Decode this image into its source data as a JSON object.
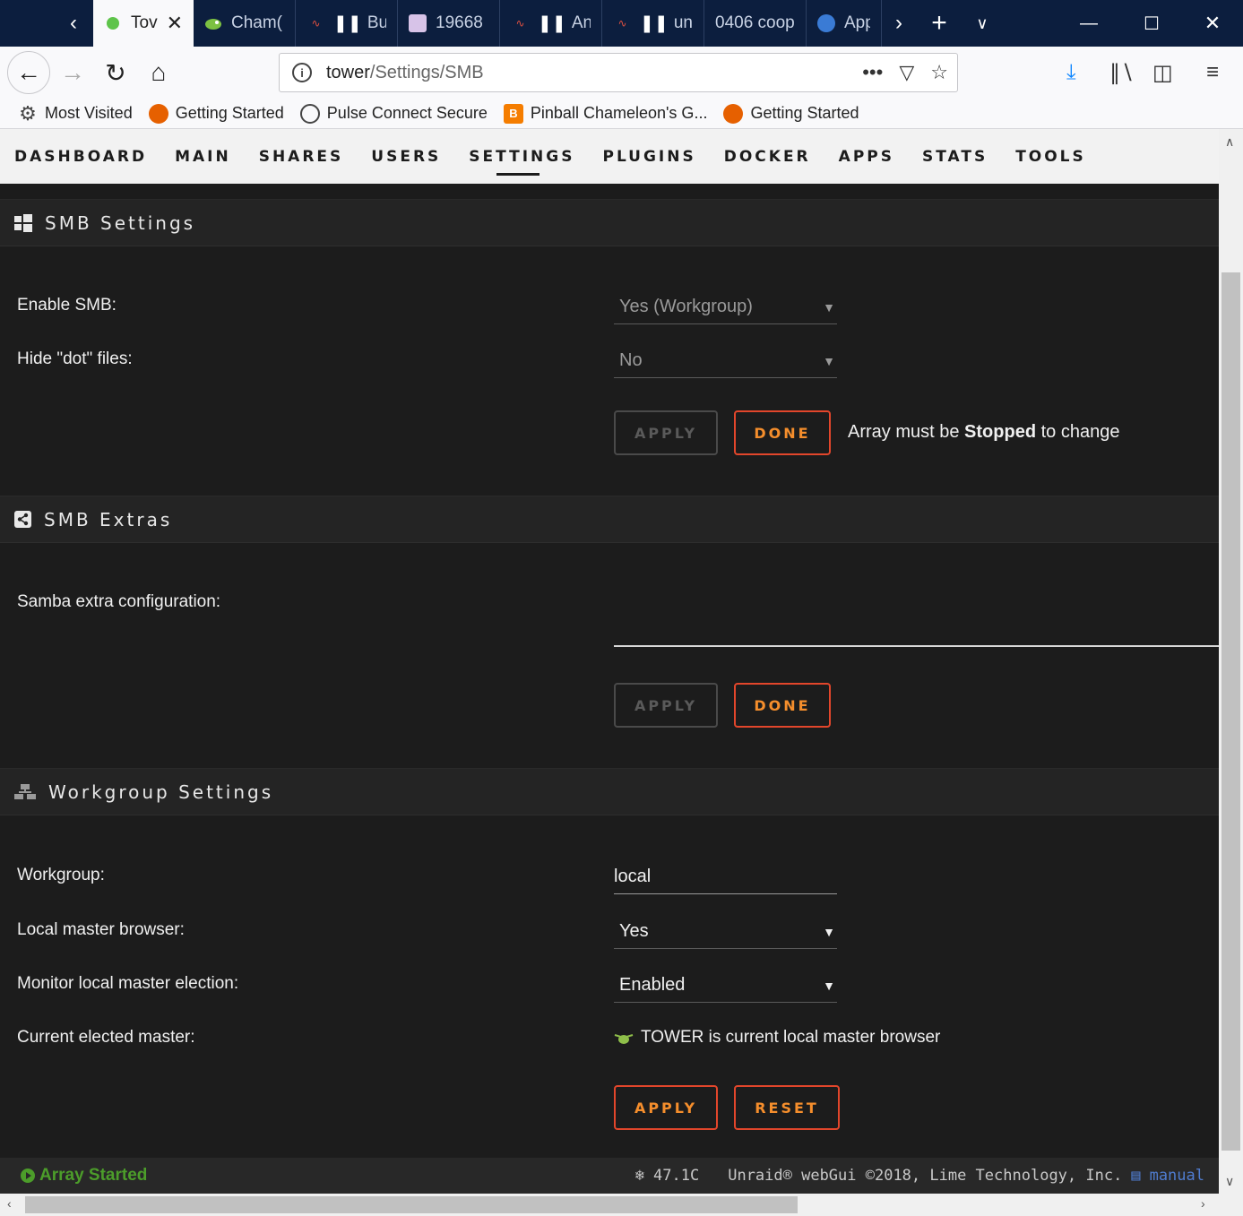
{
  "browser": {
    "tabs": [
      {
        "label": "Tov",
        "icon": "green-dot-icon",
        "active": true
      },
      {
        "label": "Cham(",
        "icon": "chameleon-icon"
      },
      {
        "label": "Bug",
        "icon": "unraid-wave-icon"
      },
      {
        "label": "19668",
        "icon": "avatar-icon"
      },
      {
        "label": "Any",
        "icon": "unraid-wave-icon"
      },
      {
        "label": "unra",
        "icon": "unraid-wave-icon"
      },
      {
        "label": "0406 coop",
        "icon": ""
      },
      {
        "label": "App",
        "icon": "app-globe-icon"
      }
    ],
    "url_host": "tower",
    "url_path": "/Settings/SMB",
    "bookmarks": [
      {
        "label": "Most Visited",
        "icon": "gear-icon"
      },
      {
        "label": "Getting Started",
        "icon": "firefox-icon"
      },
      {
        "label": "Pulse Connect Secure",
        "icon": "globe-icon"
      },
      {
        "label": "Pinball Chameleon's G...",
        "icon": "blogger-icon"
      },
      {
        "label": "Getting Started",
        "icon": "firefox-icon"
      }
    ]
  },
  "menu": {
    "items": [
      "DASHBOARD",
      "MAIN",
      "SHARES",
      "USERS",
      "SETTINGS",
      "PLUGINS",
      "DOCKER",
      "APPS",
      "STATS",
      "TOOLS"
    ],
    "active": "SETTINGS"
  },
  "smb_settings": {
    "title": "SMB Settings",
    "enable_label": "Enable SMB:",
    "enable_value": "Yes (Workgroup)",
    "hide_dot_label": "Hide \"dot\" files:",
    "hide_dot_value": "No",
    "apply": "APPLY",
    "done": "DONE",
    "note_prefix": "Array must be ",
    "note_bold": "Stopped",
    "note_suffix": " to change"
  },
  "smb_extras": {
    "title": "SMB Extras",
    "config_label": "Samba extra configuration:",
    "apply": "APPLY",
    "done": "DONE"
  },
  "workgroup": {
    "title": "Workgroup Settings",
    "workgroup_label": "Workgroup:",
    "workgroup_value": "local",
    "lmb_label": "Local master browser:",
    "lmb_value": "Yes",
    "monitor_label": "Monitor local master election:",
    "monitor_value": "Enabled",
    "current_label": "Current elected master:",
    "current_value": "TOWER is current local master browser",
    "apply": "APPLY",
    "reset": "RESET"
  },
  "footer": {
    "status": "Array Started",
    "temp": "47.1C",
    "copyright": "Unraid® webGui ©2018, Lime Technology, Inc.",
    "manual": "manual"
  },
  "colors": {
    "accent_orange": "#f58e2c",
    "accent_red": "#e2462b",
    "status_green": "#4c9d2a",
    "link_blue": "#4f7ccf"
  }
}
